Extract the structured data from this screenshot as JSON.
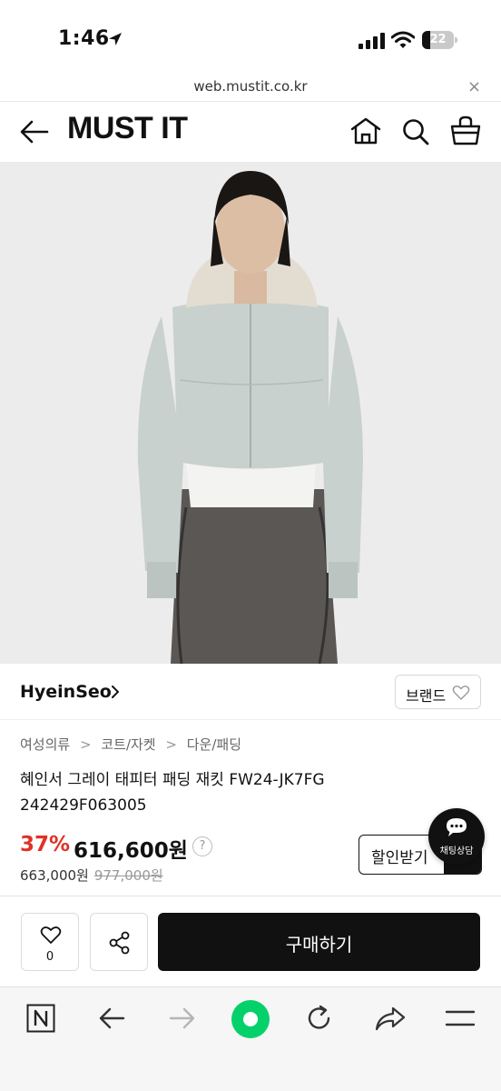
{
  "status_bar": {
    "time": "1:46",
    "battery": "22"
  },
  "browser": {
    "url": "web.mustit.co.kr",
    "close_symbol": "×"
  },
  "header": {
    "logo": "MUST IT",
    "icons": [
      "back-arrow-icon",
      "home-icon",
      "search-icon",
      "cart-icon"
    ]
  },
  "product": {
    "brand": "HyeinSeo",
    "brand_button_label": "브랜드",
    "breadcrumb": [
      "여성의류",
      "코트/자켓",
      "다운/패딩"
    ],
    "breadcrumb_separator": ">",
    "title": "혜인서 그레이 태피터 패딩 재킷 FW24-JK7FG 242429F063005",
    "discount": "37%",
    "price": "616,600원",
    "price_help": "?",
    "sub_price": "663,000원",
    "original_price": "977,000원",
    "coupon_label": "할인받기",
    "image_colors": {
      "background": "#ececec",
      "jacket": "#c9d1ce",
      "skirt": "#5b5754",
      "shirt": "#f3f3f1"
    }
  },
  "chat": {
    "label": "채팅상담"
  },
  "actions": {
    "like_count": "0",
    "buy_label": "구매하기"
  },
  "colors": {
    "accent_red": "#e03126",
    "primary_black": "#111111",
    "naver_green": "#05d16b"
  }
}
